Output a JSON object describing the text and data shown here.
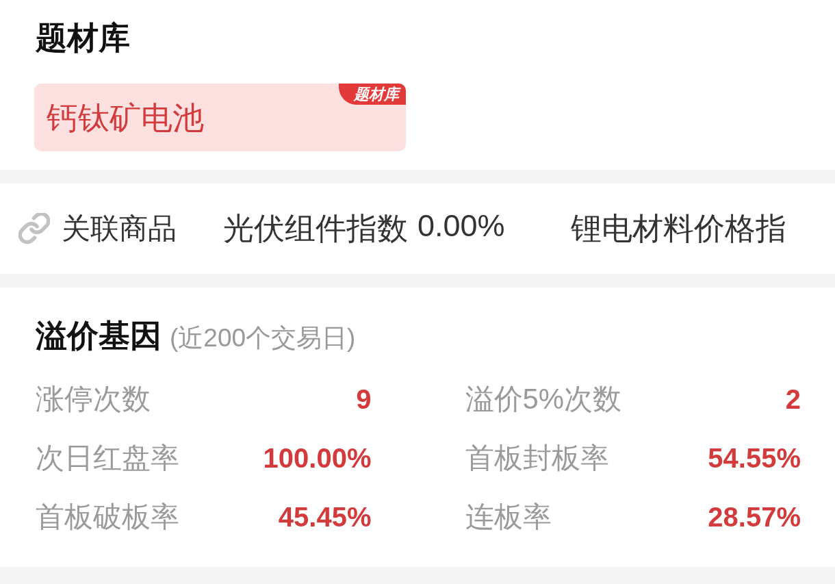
{
  "topic_library": {
    "title": "题材库",
    "card": {
      "name": "钙钛矿电池",
      "tag": "题材库"
    }
  },
  "related_products": {
    "label": "关联商品",
    "items": [
      {
        "name": "光伏组件指数",
        "change": "0.00%"
      },
      {
        "name": "锂电材料价格指"
      }
    ]
  },
  "premium_gene": {
    "title": "溢价基因",
    "subtitle": "(近200个交易日)",
    "stats": [
      {
        "label": "涨停次数",
        "value": "9"
      },
      {
        "label": "溢价5%次数",
        "value": "2"
      },
      {
        "label": "次日红盘率",
        "value": "100.00%"
      },
      {
        "label": "首板封板率",
        "value": "54.55%"
      },
      {
        "label": "首板破板率",
        "value": "45.45%"
      },
      {
        "label": "连板率",
        "value": "28.57%"
      }
    ]
  }
}
